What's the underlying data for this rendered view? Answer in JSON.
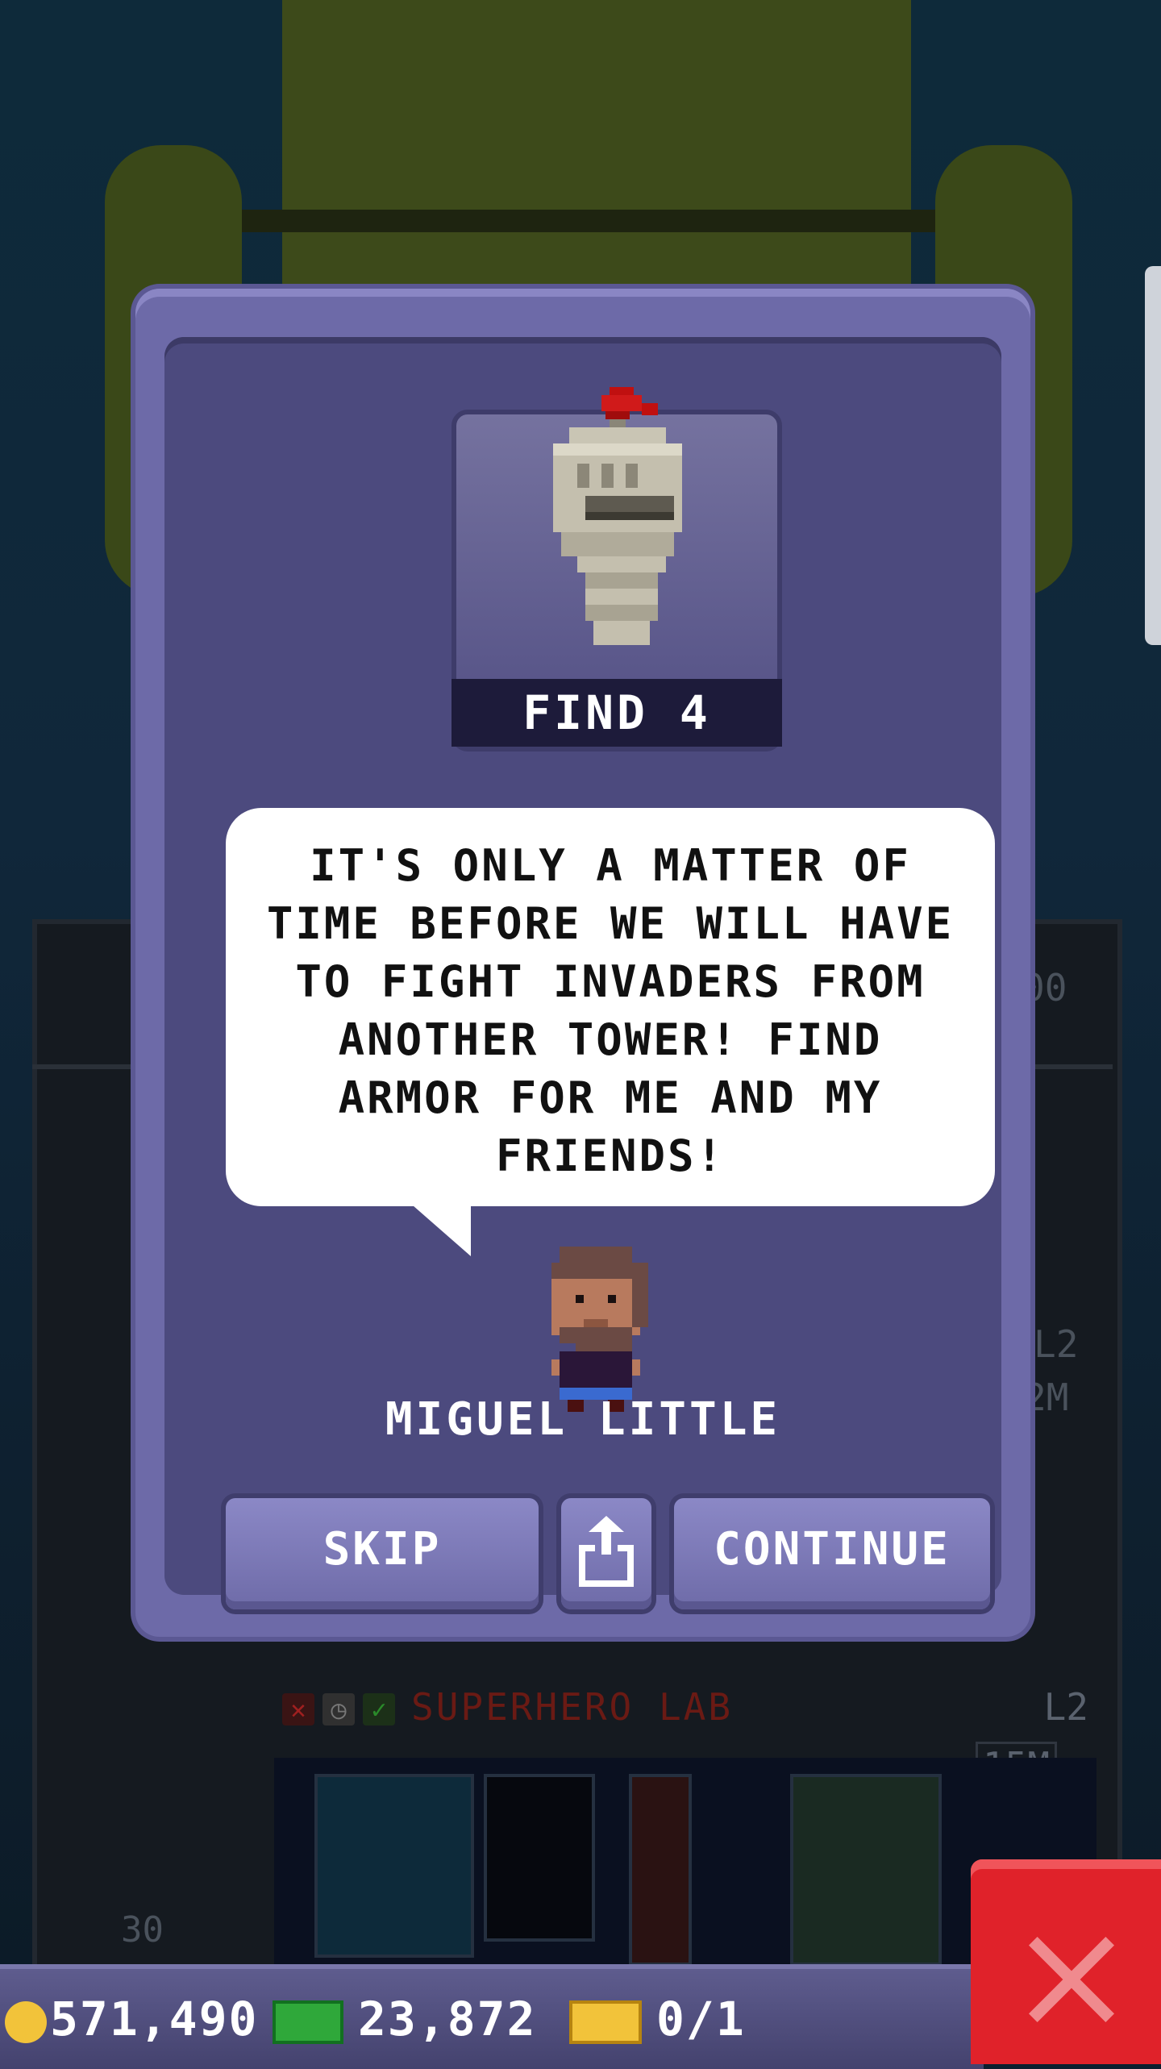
{
  "popup": {
    "item_caption": "FIND 4",
    "speech": "IT'S ONLY A MATTER OF TIME BEFORE WE WILL HAVE TO FIGHT INVADERS FROM ANOTHER TOWER! FIND ARMOR FOR ME AND MY FRIENDS!",
    "character_name": "MIGUEL LITTLE",
    "buttons": {
      "skip": "SKIP",
      "share_icon": "share-icon",
      "continue": "CONTINUE"
    }
  },
  "background": {
    "floor_name": "SUPERHERO LAB",
    "floor_level": "L2",
    "floor_cost": "15M",
    "side_level": "L2",
    "side_cost": "2M",
    "side_top": "00",
    "left_number": "30"
  },
  "status_bar": {
    "coins": "571,490",
    "bux": "23,872",
    "tickets": "0/1"
  },
  "colors": {
    "dialog": "#6d6aa8",
    "dialog_inner": "#4c4a7e",
    "close_button": "#e0222a",
    "coin": "#f2c33a",
    "bux": "#2fa83a"
  }
}
